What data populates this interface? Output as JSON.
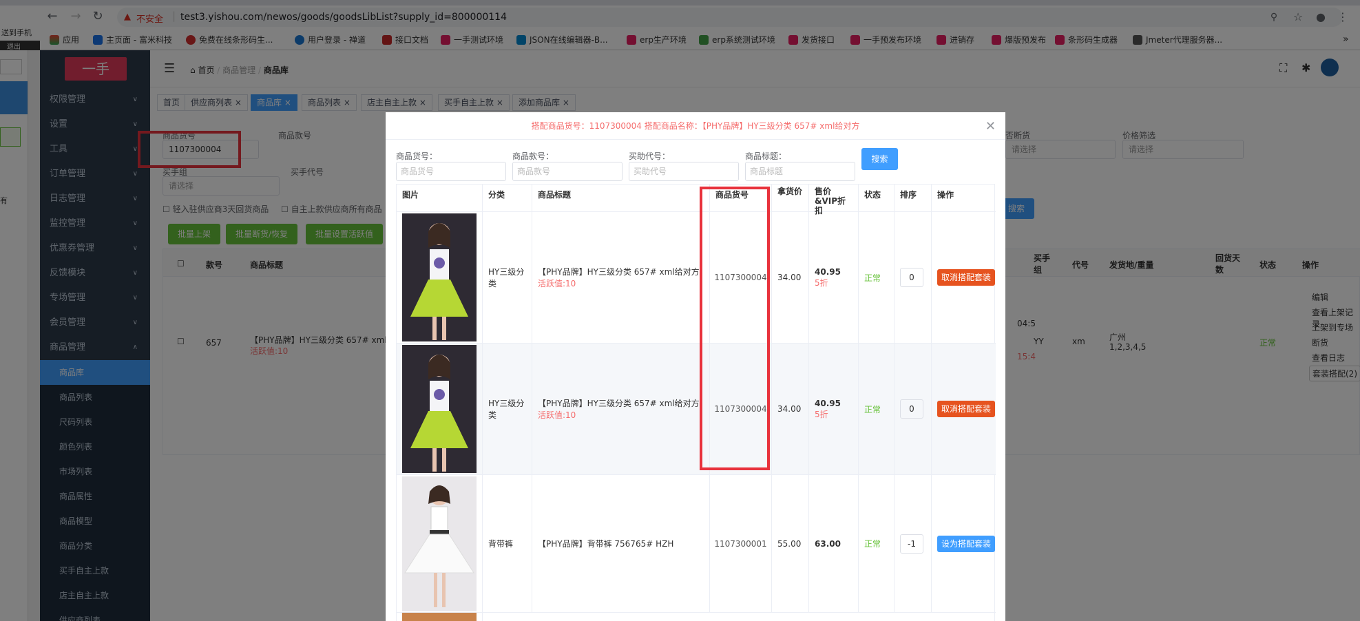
{
  "browser": {
    "security_label": "不安全",
    "url": "test3.yishou.com/newos/goods/goodsLibList?supply_id=800000114",
    "bookmarks": [
      "应用",
      "主页面 - 富米科技",
      "免费在线条形码生...",
      "用户登录 - 禅道",
      "接口文档",
      "一手测试环境",
      "JSON在线编辑器-B...",
      "erp生产环境",
      "erp系统测试环境",
      "发货接口",
      "一手预发布环境",
      "进销存",
      "爆版预发布",
      "条形码生成器",
      "Jmeter代理服务器..."
    ]
  },
  "left_strip": {
    "send": "送到手机",
    "exit": "退出",
    "has": "有"
  },
  "sidebar": {
    "logo": "一手",
    "menus": [
      "权限管理",
      "设置",
      "工具",
      "订单管理",
      "日志管理",
      "监控管理",
      "优惠券管理",
      "反馈模块",
      "专场管理",
      "会员管理",
      "商品管理"
    ],
    "submenus": [
      "商品库",
      "商品列表",
      "尺码列表",
      "颜色列表",
      "市场列表",
      "商品属性",
      "商品模型",
      "商品分类",
      "买手自主上款",
      "店主自主上款",
      "供应商列表"
    ]
  },
  "header": {
    "breadcrumb": [
      "首页",
      "商品管理",
      "商品库"
    ]
  },
  "tags": [
    "首页",
    "供应商列表",
    "商品库",
    "商品列表",
    "店主自主上款",
    "买手自主上款",
    "添加商品库"
  ],
  "filters": {
    "goods_no_label": "商品货号",
    "goods_no_value": "1107300004",
    "goods_kuan_label": "商品款号",
    "buyer_group_label": "买手组",
    "buyer_group_placeholder": "请选择",
    "buyer_code_label": "买手代号",
    "stock_label": "否断货",
    "stock_placeholder": "请选择",
    "price_label": "价格筛选",
    "price_placeholder": "请选择",
    "check1": "轻入驻供应商3天回货商品",
    "check2": "自主上款供应商所有商品",
    "search": "搜索"
  },
  "actions": {
    "batch_up": "批量上架",
    "batch_stock": "批量断货/恢复",
    "batch_active": "批量设置活跃值"
  },
  "bg_table": {
    "headers": [
      "款号",
      "商品标题",
      "买手组",
      "代号",
      "发货地/重量",
      "回货天数",
      "状态",
      "操作"
    ],
    "row": {
      "kuan": "657",
      "title": "【PHY品牌】HY三级分类 657# xml",
      "active": "活跃值:10",
      "time1": "04:5",
      "time2": "15:4",
      "buyer_group": "YY",
      "code": "xm",
      "place": "广州",
      "weight": "1,2,3,4,5",
      "status": "正常",
      "ops": [
        "编辑",
        "查看上架记录",
        "上架到专场",
        "断货",
        "查看日志",
        "套装搭配(2)"
      ]
    }
  },
  "dialog": {
    "title": "搭配商品货号：1107300004 搭配商品名称：【PHY品牌】HY三级分类 657# xml给对方",
    "fields": [
      {
        "label": "商品货号：",
        "placeholder": "商品货号"
      },
      {
        "label": "商品款号：",
        "placeholder": "商品款号"
      },
      {
        "label": "买助代号：",
        "placeholder": "买助代号"
      },
      {
        "label": "商品标题：",
        "placeholder": "商品标题"
      }
    ],
    "search": "搜索",
    "headers": [
      "图片",
      "分类",
      "商品标题",
      "商品货号",
      "拿货价",
      "售价&VIP折扣",
      "状态",
      "排序",
      "操作"
    ],
    "rows": [
      {
        "category": "HY三级分类",
        "title": "【PHY品牌】HY三级分类 657# xml给对方",
        "active": "活跃值:10",
        "goods_no": "1107300004",
        "cost": "34.00",
        "price": "40.95",
        "discount": "5折",
        "status": "正常",
        "sort": "0",
        "op": "取消搭配套装"
      },
      {
        "category": "HY三级分类",
        "title": "【PHY品牌】HY三级分类 657# xml给对方",
        "active": "活跃值:10",
        "goods_no": "1107300004",
        "cost": "34.00",
        "price": "40.95",
        "discount": "5折",
        "status": "正常",
        "sort": "0",
        "op": "取消搭配套装"
      },
      {
        "category": "背带裤",
        "title": "【PHY品牌】背带裤 756765# HZH",
        "active": "",
        "goods_no": "1107300001",
        "cost": "55.00",
        "price": "63.00",
        "discount": "",
        "status": "正常",
        "sort": "-1",
        "op": "设为搭配套装"
      }
    ]
  }
}
